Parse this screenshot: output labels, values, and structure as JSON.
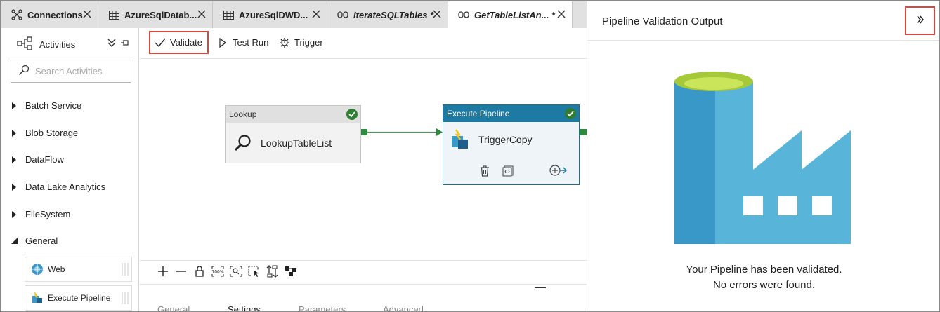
{
  "tabs": [
    {
      "label": "Connections",
      "icon": "connections-icon",
      "italic": false
    },
    {
      "label": "AzureSqlDatab...",
      "icon": "table-icon",
      "italic": false
    },
    {
      "label": "AzureSqlDWD...",
      "icon": "table-icon",
      "italic": false
    },
    {
      "label": "IterateSQLTables *",
      "icon": "pipeline-icon",
      "italic": true
    },
    {
      "label": "GetTableListAn... *",
      "icon": "pipeline-icon",
      "italic": true
    }
  ],
  "activities": {
    "title": "Activities",
    "search_placeholder": "Search Activities",
    "categories": [
      "Batch Service",
      "Blob Storage",
      "DataFlow",
      "Data Lake Analytics",
      "FileSystem",
      "General"
    ],
    "items": [
      {
        "label": "Web",
        "icon": "globe-icon"
      },
      {
        "label": "Execute Pipeline",
        "icon": "execute-pipeline-icon"
      }
    ]
  },
  "toolbar": {
    "validate_label": "Validate",
    "test_run_label": "Test Run",
    "trigger_label": "Trigger"
  },
  "canvas": {
    "lookup": {
      "type_label": "Lookup",
      "name": "LookupTableList",
      "status": "succeeded"
    },
    "execute": {
      "type_label": "Execute Pipeline",
      "name": "TriggerCopy",
      "status": "succeeded"
    }
  },
  "property_tabs": [
    "General",
    "Settings",
    "Parameters",
    "Advanced"
  ],
  "validation_panel": {
    "title": "Pipeline Validation Output",
    "message_line1": "Your Pipeline has been validated.",
    "message_line2": "No errors were found."
  },
  "colors": {
    "accent_red": "#d9463c",
    "pipeline_blue": "#1d7aa3",
    "success_green": "#2e7d32",
    "factory_blue_dark": "#3a98c8",
    "factory_blue_light": "#59b4d9",
    "factory_green": "#b8d432"
  }
}
